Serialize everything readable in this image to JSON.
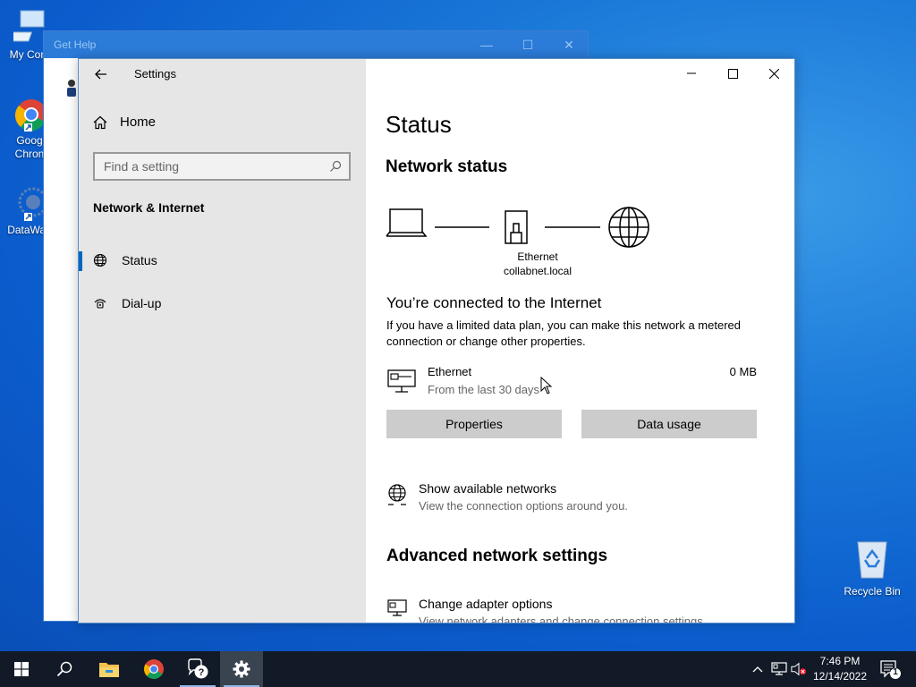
{
  "desktop": {
    "icons": [
      {
        "label": "My Com",
        "icon": "computer-icon"
      },
      {
        "label": "Goog\nChron",
        "icon": "chrome-icon"
      },
      {
        "label": "DataWag",
        "icon": "datawagon-icon"
      }
    ],
    "recycle_bin": {
      "label": "Recycle Bin",
      "icon": "recycle-bin-icon"
    }
  },
  "get_help_window": {
    "title": "Get Help"
  },
  "settings_window": {
    "title": "Settings",
    "sidebar": {
      "home_label": "Home",
      "search_placeholder": "Find a setting",
      "section_title": "Network & Internet",
      "items": [
        {
          "label": "Status",
          "icon": "globe-status-icon",
          "active": true
        },
        {
          "label": "Dial-up",
          "icon": "dialup-icon",
          "active": false
        }
      ]
    },
    "main": {
      "page_title": "Status",
      "network_status_heading": "Network status",
      "diagram": {
        "adapter_label": "Ethernet",
        "domain_label": "collabnet.local"
      },
      "connected_heading": "You’re connected to the Internet",
      "connected_desc": "If you have a limited data plan, you can make this network a metered connection or change other properties.",
      "ethernet": {
        "name": "Ethernet",
        "subtitle": "From the last 30 days",
        "usage": "0 MB"
      },
      "buttons": {
        "properties": "Properties",
        "data_usage": "Data usage"
      },
      "show_networks": {
        "label": "Show available networks",
        "sub": "View the connection options around you."
      },
      "advanced_heading": "Advanced network settings",
      "change_adapter": {
        "label": "Change adapter options",
        "sub": "View network adapters and change connection settings."
      }
    }
  },
  "taskbar": {
    "clock_time": "7:46 PM",
    "clock_date": "12/14/2022",
    "notification_count": "1",
    "pinned": [
      "start-icon",
      "search-icon",
      "file-explorer-icon",
      "chrome-icon",
      "get-help-icon",
      "settings-gear-icon"
    ]
  },
  "colors": {
    "accent": "#0067c0",
    "sidebar_bg": "#e6e6e6",
    "taskbar_bg": "#111a26",
    "desktop": "#0b5ccc"
  }
}
